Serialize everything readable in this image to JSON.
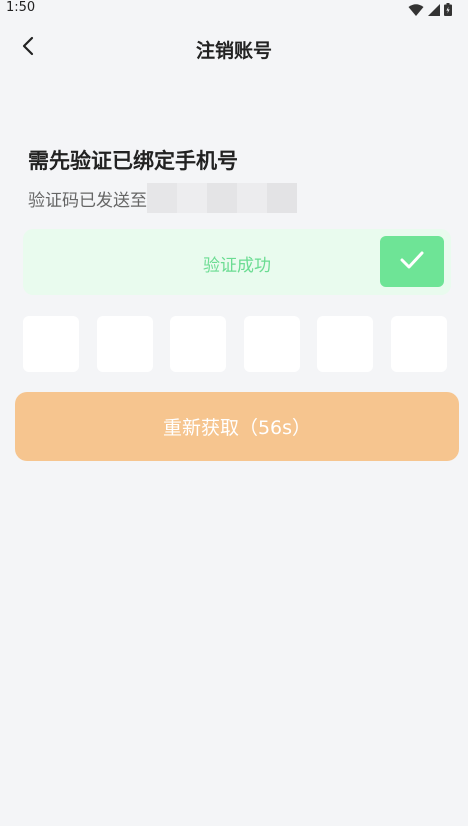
{
  "status_bar": {
    "time": "1:50"
  },
  "nav": {
    "title": "注销账号",
    "back_icon": "chevron-left-icon"
  },
  "main": {
    "heading": "需先验证已绑定手机号",
    "sent_prefix": "验证码已发送至",
    "verify_status": "验证成功",
    "code_digits": [
      "",
      "",
      "",
      "",
      "",
      ""
    ],
    "resend_label": "重新获取（56s）"
  },
  "colors": {
    "background": "#f4f5f7",
    "success_bg": "#e9fbee",
    "success_text": "#6bdc92",
    "success_check": "#6ee496",
    "resend_button": "#f6c58f"
  }
}
